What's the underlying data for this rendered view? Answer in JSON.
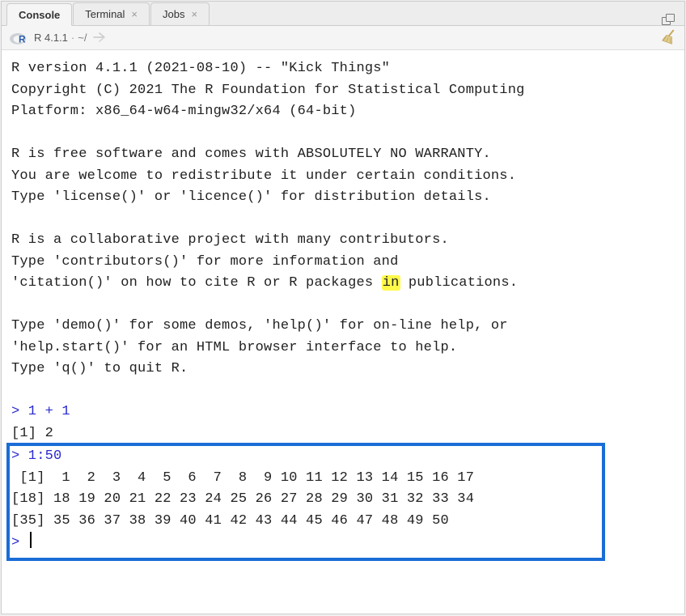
{
  "tabs": [
    {
      "label": "Console",
      "closable": false
    },
    {
      "label": "Terminal",
      "closable": true
    },
    {
      "label": "Jobs",
      "closable": true
    }
  ],
  "info": {
    "version": "R 4.1.1",
    "path": "~/"
  },
  "banner": {
    "line1": "R version 4.1.1 (2021-08-10) -- \"Kick Things\"",
    "line2": "Copyright (C) 2021 The R Foundation for Statistical Computing",
    "line3": "Platform: x86_64-w64-mingw32/x64 (64-bit)",
    "line4": "R is free software and comes with ABSOLUTELY NO WARRANTY.",
    "line5": "You are welcome to redistribute it under certain conditions.",
    "line6": "Type 'license()' or 'licence()' for distribution details.",
    "line7": "R is a collaborative project with many contributors.",
    "line8": "Type 'contributors()' for more information and",
    "line9a": "'citation()' on how to cite R or R packages ",
    "line9_hl": "in",
    "line9b": " publications.",
    "line10": "Type 'demo()' for some demos, 'help()' for on-line help, or",
    "line11": "'help.start()' for an HTML browser interface to help.",
    "line12": "Type 'q()' to quit R."
  },
  "session": {
    "in1": "> 1 + 1",
    "out1": "[1] 2",
    "in2": "> 1:50",
    "out2a": " [1]  1  2  3  4  5  6  7  8  9 10 11 12 13 14 15 16 17",
    "out2b": "[18] 18 19 20 21 22 23 24 25 26 27 28 29 30 31 32 33 34",
    "out2c": "[35] 35 36 37 38 39 40 41 42 43 44 45 46 47 48 49 50",
    "prompt": "> "
  }
}
